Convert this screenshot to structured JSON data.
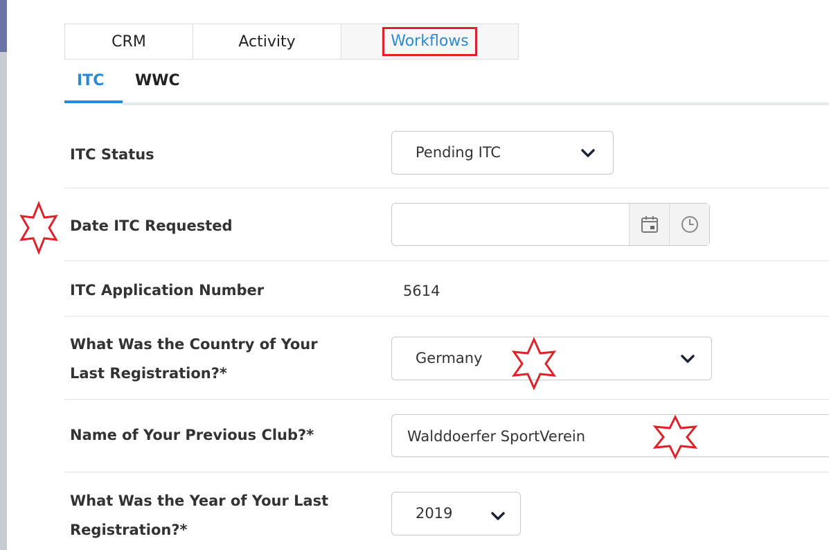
{
  "tabs": [
    {
      "label": "CRM"
    },
    {
      "label": "Activity"
    },
    {
      "label": "Workflows",
      "active": true
    }
  ],
  "subtabs": [
    {
      "label": "ITC",
      "active": true
    },
    {
      "label": "WWC"
    }
  ],
  "form": {
    "itc_status": {
      "label": "ITC Status",
      "value": "Pending ITC"
    },
    "date_requested": {
      "label": "Date ITC Requested",
      "value": ""
    },
    "application_number": {
      "label": "ITC Application Number",
      "value": "5614"
    },
    "country": {
      "label_line1": "What Was the Country of Your",
      "label_line2": "Last Registration?*",
      "value": "Germany"
    },
    "previous_club": {
      "label": "Name of Your Previous Club?*",
      "value": "Walddoerfer SportVerein"
    },
    "year": {
      "label_line1": "What Was the Year of Your Last",
      "label_line2": "Registration?*",
      "value": "2019"
    }
  },
  "colors": {
    "accent": "#2a8ad3",
    "highlight": "#e2202a"
  },
  "icons": {
    "calendar": "calendar-icon",
    "clock": "clock-icon",
    "chevron": "chevron-down-icon",
    "star": "star-marker-icon"
  }
}
